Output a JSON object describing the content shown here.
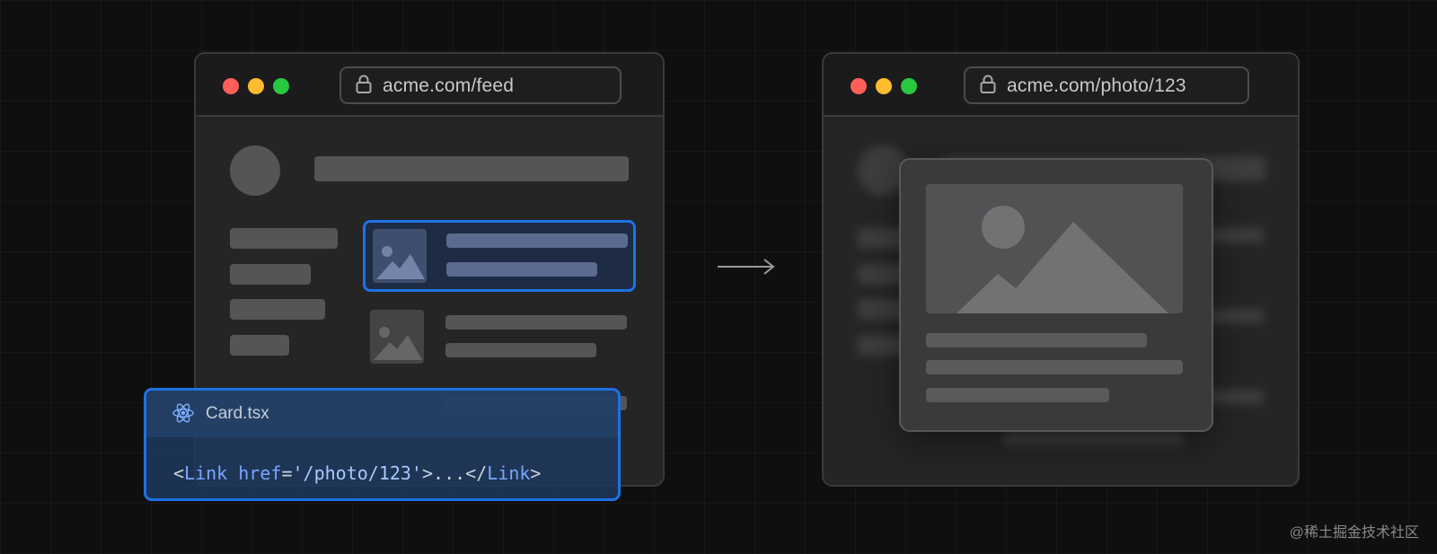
{
  "left_window": {
    "url": "acme.com/feed",
    "dot_colors": [
      "#ff5f57",
      "#febc2e",
      "#28c840"
    ]
  },
  "right_window": {
    "url": "acme.com/photo/123",
    "dot_colors": [
      "#ff5f57",
      "#febc2e",
      "#28c840"
    ]
  },
  "code_card": {
    "filename": "Card.tsx",
    "code": {
      "open_lt": "<",
      "tag": "Link",
      "attr": " href",
      "eq": "=",
      "value": "'/photo/123'",
      "gt_dots": ">...",
      "close_lt": "</",
      "close_tag": "Link",
      "close_gt": ">"
    }
  },
  "watermark": "@稀土掘金技术社区",
  "colors": {
    "highlight": "#1e72e4",
    "background": "#0f0f10"
  },
  "icons": {
    "url_bar": "lock-icon",
    "code_file": "react-icon",
    "transition": "arrow-right-icon",
    "thumbnail": "image-icon"
  }
}
